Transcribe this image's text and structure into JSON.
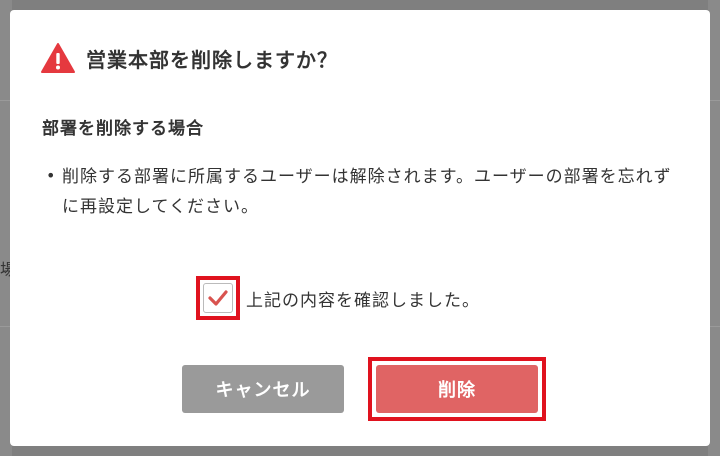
{
  "background": {
    "partial_text": "場"
  },
  "dialog": {
    "icon": "warning-triangle-icon",
    "title": "営業本部を削除しますか？",
    "section_heading": "部署を削除する場合",
    "bullet_marker": "•",
    "bullet_text": "削除する部署に所属するユーザーは解除されます。ユーザーの部署を忘れずに再設定してください。",
    "confirm": {
      "checked": true,
      "label": "上記の内容を確認しました。"
    },
    "buttons": {
      "cancel_label": "キャンセル",
      "delete_label": "削除"
    }
  },
  "colors": {
    "warning": "#e5393f",
    "delete_button": "#e06464",
    "cancel_button": "#9a9a9a",
    "highlight": "#e0121e",
    "checkmark": "#d9534f"
  }
}
